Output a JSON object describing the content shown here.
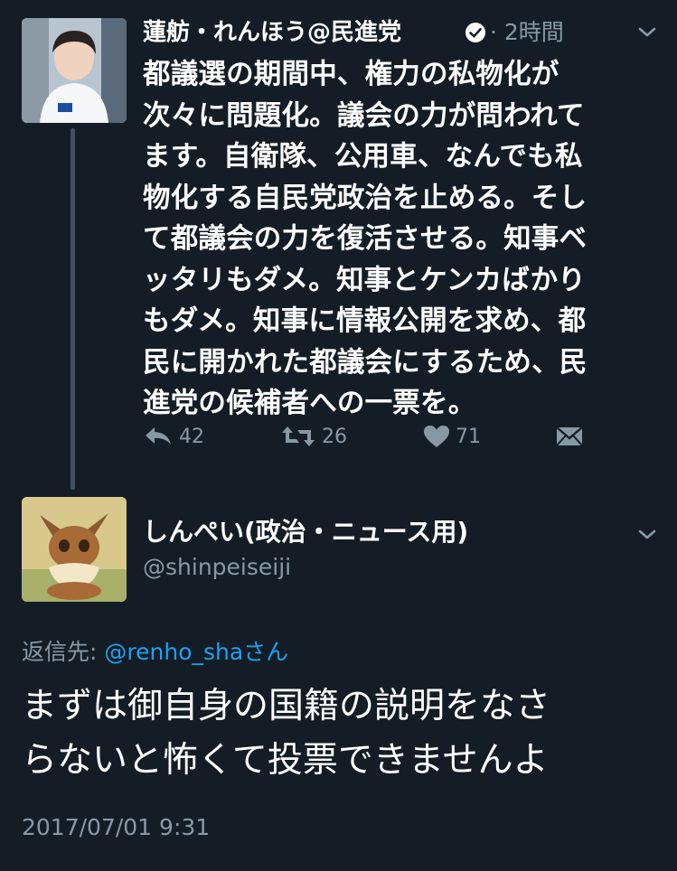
{
  "tweet1": {
    "display_name": "蓮舫・れんほう@民進党",
    "time": "· 2時間",
    "body": "都議選の期間中、権力の私物化が\n次々に問題化。議会の力が問われて\nます。自衛隊、公用車、なんでも私\n物化する自民党政治を止める。そし\nて都議会の力を復活させる。知事ベ\nッタリもダメ。知事とケンカばかり\nもダメ。知事に情報公開を求め、都\n民に開かれた都議会にするため、民\n進党の候補者への一票を。",
    "reply_count": "42",
    "retweet_count": "26",
    "like_count": "71"
  },
  "tweet2": {
    "display_name": "しんぺい(政治・ニュース用)",
    "handle": "@shinpeiseiji",
    "reply_label": "返信先:",
    "reply_mention": "@renho_shaさん",
    "body": "まずは御自身の国籍の説明をなさ\nらないと怖くて投票できませんよ",
    "datetime": "2017/07/01 9:31"
  },
  "colors": {
    "background": "#141d26",
    "text": "#ffffff",
    "muted": "#8899a6",
    "link": "#1da1f2",
    "verified_badge": "#ffffff"
  },
  "icons": [
    "verified-icon",
    "chevron-down-icon",
    "reply-icon",
    "retweet-icon",
    "heart-icon",
    "direct-message-icon"
  ]
}
